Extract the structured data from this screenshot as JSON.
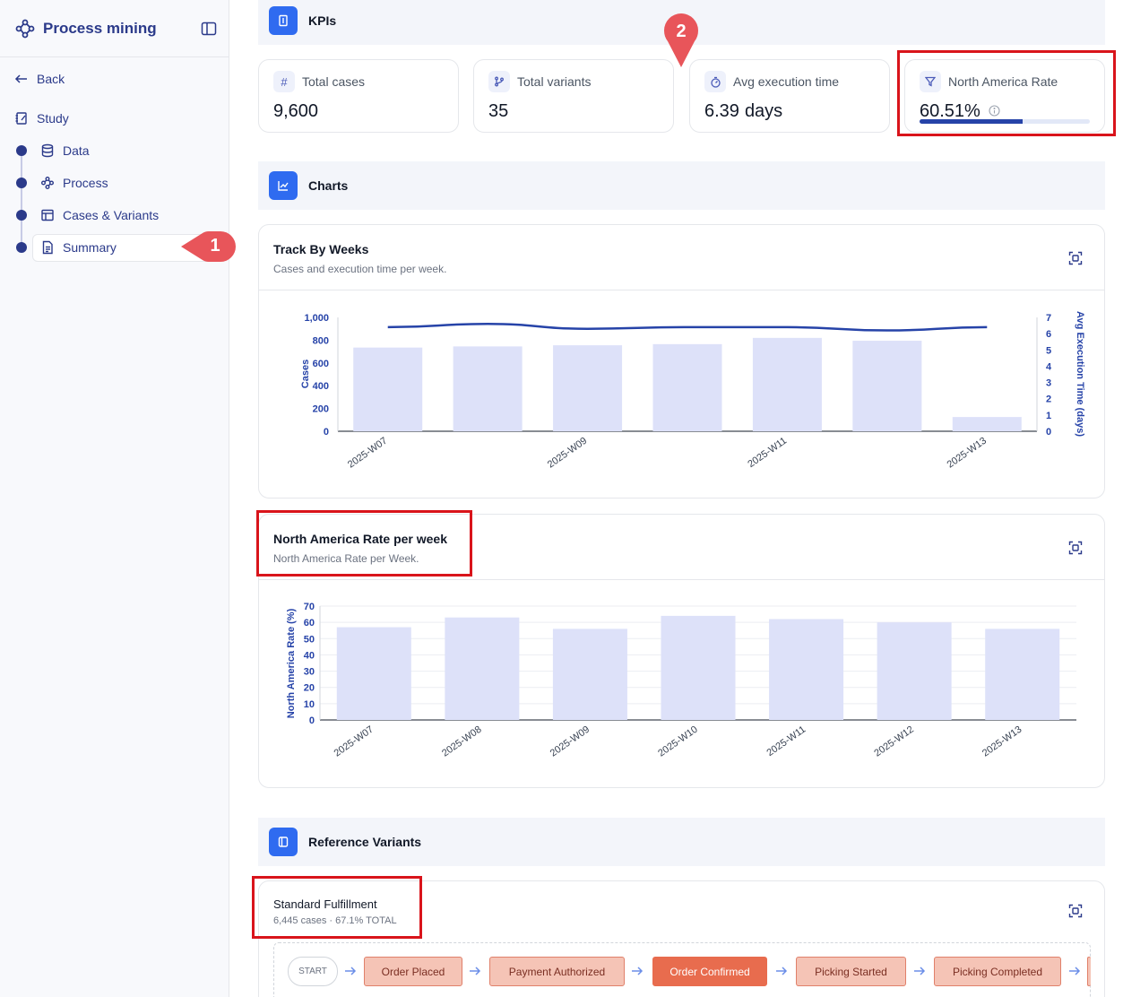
{
  "sidebar": {
    "title": "Process mining",
    "back_label": "Back",
    "study_label": "Study",
    "items": [
      {
        "label": "Data"
      },
      {
        "label": "Process"
      },
      {
        "label": "Cases & Variants"
      },
      {
        "label": "Summary"
      }
    ]
  },
  "callouts": {
    "one": "1",
    "two": "2"
  },
  "kpis_section": {
    "title": "KPIs"
  },
  "kpis": [
    {
      "label": "Total cases",
      "value": "9,600",
      "icon": "hash-icon"
    },
    {
      "label": "Total variants",
      "value": "35",
      "icon": "git-branch-icon"
    },
    {
      "label": "Avg execution time",
      "value": "6.39",
      "unit": "days",
      "icon": "timer-icon"
    },
    {
      "label": "North America Rate",
      "value": "60.51%",
      "icon": "filter-icon",
      "progress": 0.6051
    }
  ],
  "charts_section": {
    "title": "Charts"
  },
  "track_chart": {
    "title": "Track By Weeks",
    "subtitle": "Cases and execution time per week."
  },
  "rate_chart": {
    "title": "North America Rate per week",
    "subtitle": "North America Rate per Week."
  },
  "chart_data": [
    {
      "type": "bar",
      "categories": [
        "2025-W07",
        "2025-W08",
        "2025-W09",
        "2025-W10",
        "2025-W11",
        "2025-W12",
        "2025-W13"
      ],
      "x_tick_labels": [
        "2025-W07",
        "2025-W09",
        "2025-W11",
        "2025-W13"
      ],
      "series": [
        {
          "name": "Cases",
          "type": "bar",
          "axis": "left",
          "values": [
            735,
            745,
            755,
            765,
            820,
            795,
            125
          ]
        },
        {
          "name": "Avg Execution Time (days)",
          "type": "line",
          "axis": "right",
          "values": [
            6.4,
            6.6,
            6.3,
            6.4,
            6.4,
            6.2,
            6.4
          ]
        }
      ],
      "ylabel": "Cases",
      "y2label": "Avg Execution Time (days)",
      "ylim": [
        0,
        1000
      ],
      "y2lim": [
        0,
        7
      ],
      "yticks": [
        "0",
        "200",
        "400",
        "600",
        "800",
        "1,000"
      ],
      "y2ticks": [
        "0",
        "1",
        "2",
        "3",
        "4",
        "5",
        "6",
        "7"
      ],
      "grid": false,
      "colors": {
        "bar": "#dde1f9",
        "line": "#2643a8",
        "axis_text": "#2643a8"
      }
    },
    {
      "type": "bar",
      "categories": [
        "2025-W07",
        "2025-W08",
        "2025-W09",
        "2025-W10",
        "2025-W11",
        "2025-W12",
        "2025-W13"
      ],
      "series": [
        {
          "name": "North America Rate (%)",
          "values": [
            57,
            63,
            56,
            64,
            62,
            60,
            56
          ]
        }
      ],
      "ylabel": "North America Rate (%)",
      "ylim": [
        0,
        70
      ],
      "yticks": [
        "0",
        "10",
        "20",
        "30",
        "40",
        "50",
        "60",
        "70"
      ],
      "grid": true,
      "colors": {
        "bar": "#dde1f9",
        "axis_text": "#2643a8"
      }
    }
  ],
  "reference_section": {
    "title": "Reference Variants"
  },
  "variant": {
    "title": "Standard Fulfillment",
    "meta": "6,445 cases · 67.1% TOTAL",
    "flow": [
      "START",
      "Order Placed",
      "Payment Authorized",
      "Order Confirmed",
      "Picking Started",
      "Picking Completed"
    ]
  },
  "colors": {
    "accent": "#2f6bf0",
    "brand": "#2b3a8a",
    "highlight_red": "#d9141b",
    "callout_red": "#e8555a"
  }
}
